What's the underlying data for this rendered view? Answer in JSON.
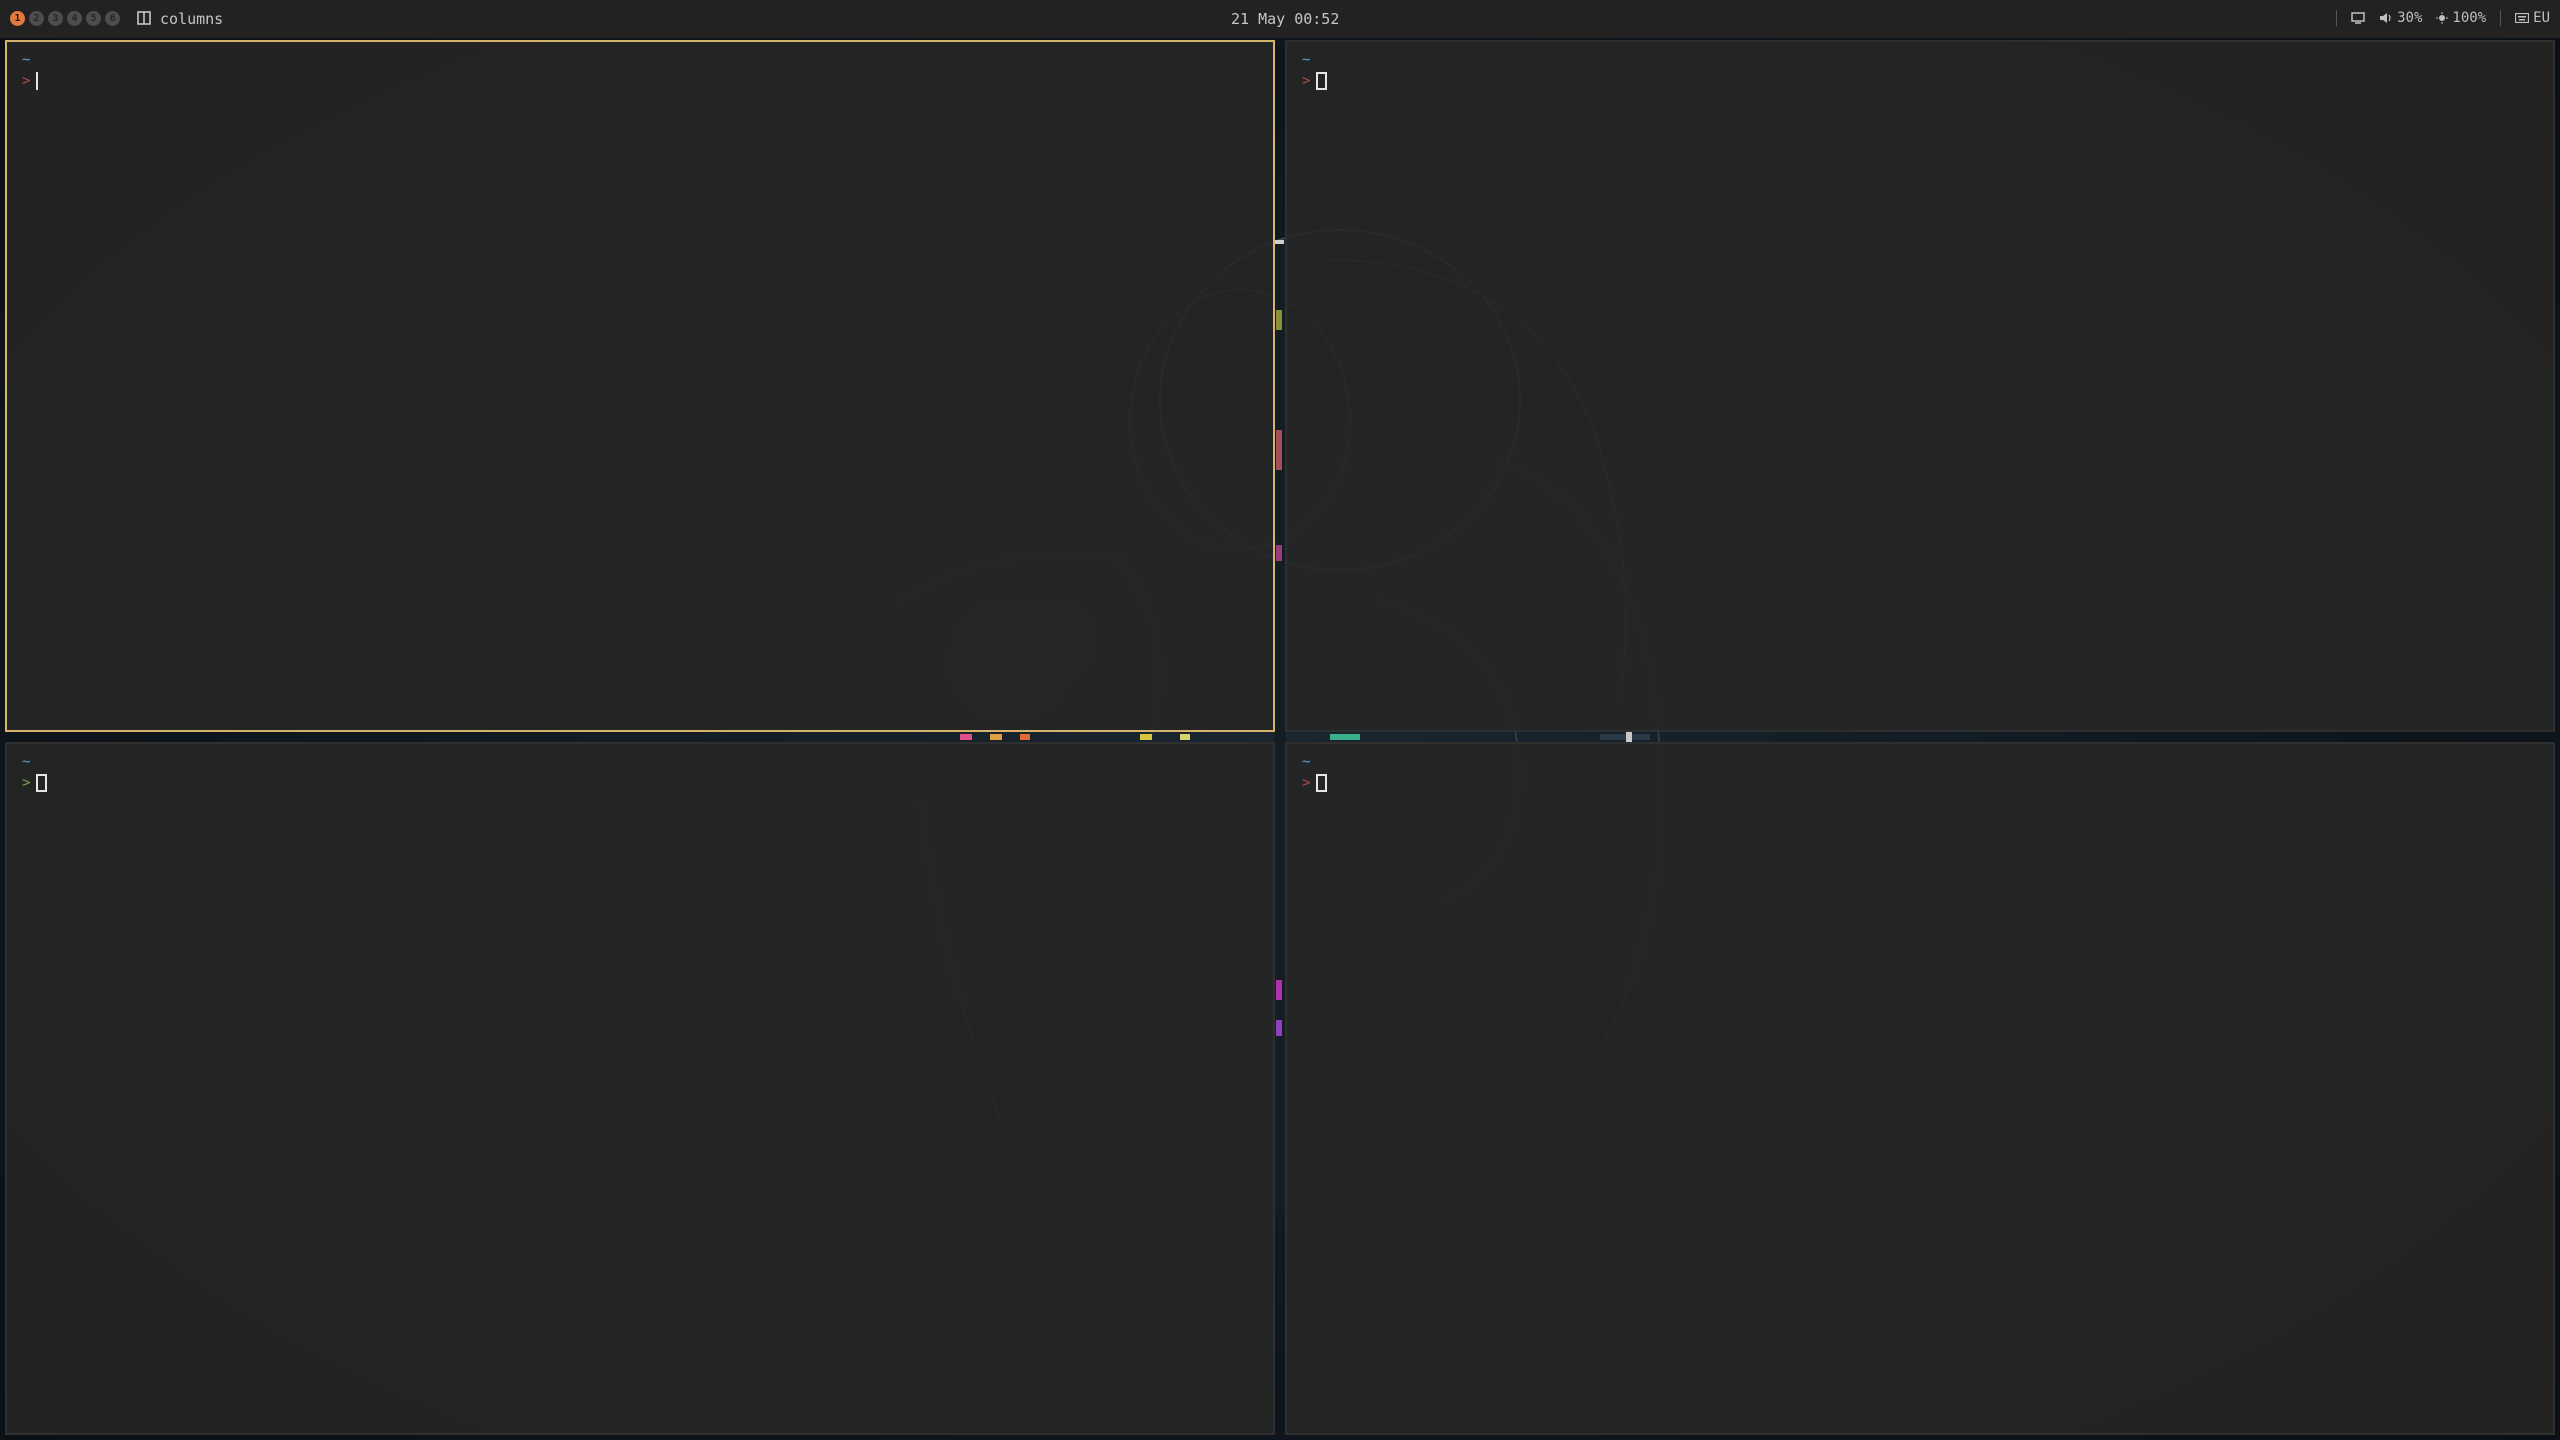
{
  "topbar": {
    "workspaces": [
      "1",
      "2",
      "3",
      "4",
      "5",
      "6"
    ],
    "active_workspace": "1",
    "layout_name": "columns",
    "clock": "21 May 00:52",
    "tray": {
      "volume": "30%",
      "brightness": "100%",
      "keyboard_layout": "EU"
    }
  },
  "terminals": [
    {
      "dir": "~",
      "prompt_symbol": ">",
      "cursor": "bar",
      "focused": true
    },
    {
      "dir": "~",
      "prompt_symbol": ">",
      "cursor": "block",
      "focused": false
    },
    {
      "dir": "~",
      "prompt_symbol": ">",
      "cursor": "block",
      "focused": false
    },
    {
      "dir": "~",
      "prompt_symbol": ">",
      "cursor": "block",
      "focused": false
    }
  ],
  "colors": {
    "focused_border": "#d6b56a",
    "active_workspace": "#e07a3e",
    "prompt_dir": "#5aa6d8",
    "prompt_error": "#b24b4b",
    "prompt_ok": "#7fa34a"
  }
}
